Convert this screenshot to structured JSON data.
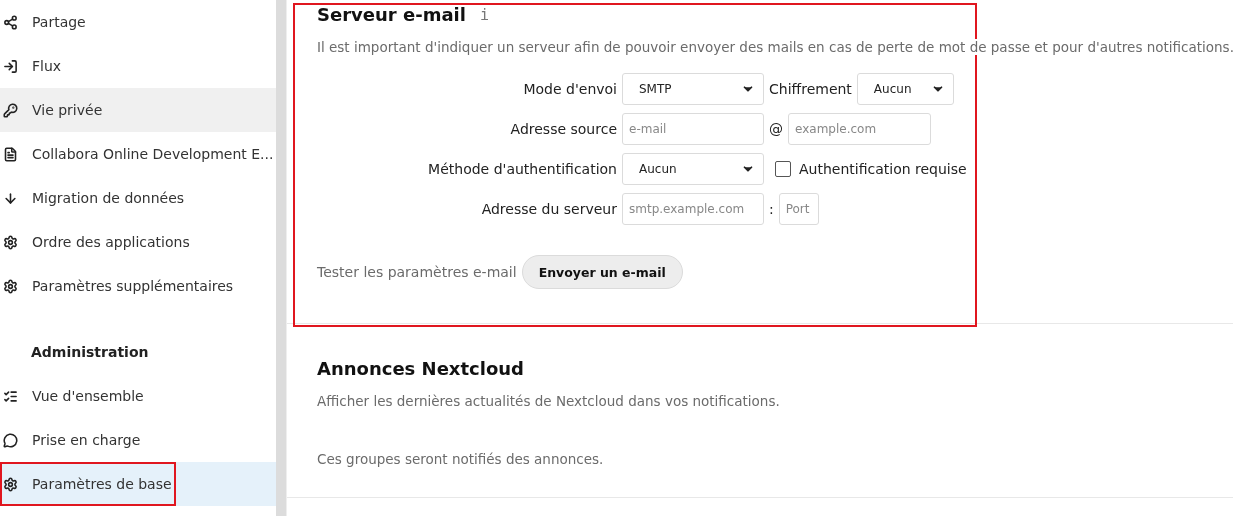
{
  "sidebar": {
    "items": [
      {
        "label": "Partage",
        "selected": false,
        "hovered": false,
        "highlighted": false
      },
      {
        "label": "Flux",
        "selected": false,
        "hovered": false,
        "highlighted": false
      },
      {
        "label": "Vie privée",
        "selected": false,
        "hovered": true,
        "highlighted": false
      },
      {
        "label": "Collabora Online Development E...",
        "selected": false,
        "hovered": false,
        "highlighted": false
      },
      {
        "label": "Migration de données",
        "selected": false,
        "hovered": false,
        "highlighted": false
      },
      {
        "label": "Ordre des applications",
        "selected": false,
        "hovered": false,
        "highlighted": false
      },
      {
        "label": "Paramètres supplémentaires",
        "selected": false,
        "hovered": false,
        "highlighted": false
      }
    ],
    "admin_heading": "Administration",
    "admin_items": [
      {
        "label": "Vue d'ensemble",
        "selected": false,
        "hovered": false,
        "highlighted": false
      },
      {
        "label": "Prise en charge",
        "selected": false,
        "hovered": false,
        "highlighted": false
      },
      {
        "label": "Paramètres de base",
        "selected": true,
        "hovered": false,
        "highlighted": true
      }
    ]
  },
  "mail_section": {
    "title": "Serveur e-mail",
    "info_icon": "i",
    "highlighted": true,
    "description": "Il est important d'indiquer un serveur afin de pouvoir envoyer des mails en cas de perte de mot de passe et pour d'autres notifications.",
    "rows": [
      {
        "label": "Mode d'envoi",
        "fields": [
          {
            "kind": "select",
            "value": "SMTP"
          },
          {
            "kind": "text",
            "text": "Chiffrement"
          },
          {
            "kind": "select",
            "value": "Aucun"
          }
        ]
      },
      {
        "label": "Adresse source",
        "fields": [
          {
            "kind": "input",
            "placeholder": "e-mail"
          },
          {
            "kind": "text",
            "text": "@"
          },
          {
            "kind": "input",
            "placeholder": "example.com"
          }
        ]
      },
      {
        "label": "Méthode d'authentification",
        "fields": [
          {
            "kind": "select",
            "value": "Aucun"
          },
          {
            "kind": "checkbox",
            "label": "Authentification requise",
            "checked": false
          }
        ]
      },
      {
        "label": "Adresse du serveur",
        "fields": [
          {
            "kind": "input",
            "placeholder": "smtp.example.com"
          },
          {
            "kind": "text",
            "text": ":"
          },
          {
            "kind": "input",
            "placeholder": "Port"
          }
        ]
      }
    ],
    "test_label": "Tester les paramètres e-mail",
    "test_button": "Envoyer un e-mail"
  },
  "news_section": {
    "title": "Annonces Nextcloud",
    "description": "Afficher les dernières actualités de Nextcloud dans vos notifications.",
    "groups_note": "Ces groupes seront notifiés des annonces."
  }
}
